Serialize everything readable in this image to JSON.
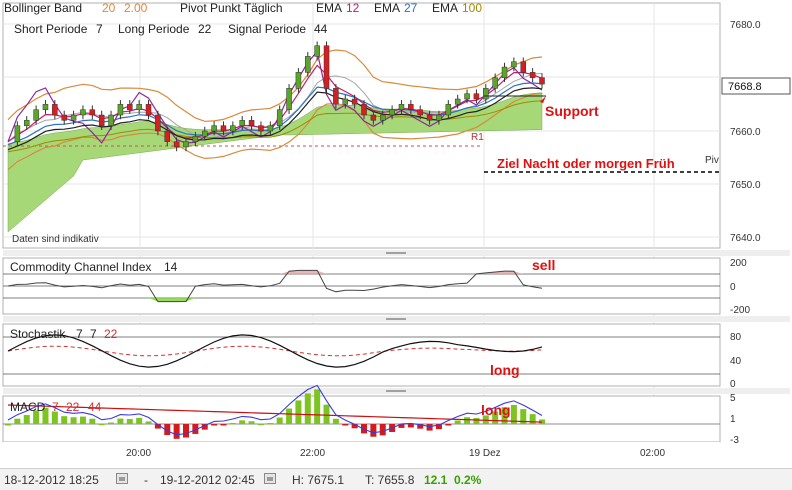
{
  "legend": {
    "bb_name": "Bollinger Band",
    "bb_p1": "20",
    "bb_p2": "2.00",
    "pivot": "Pivot Punkt  Täglich",
    "ema_label": "EMA",
    "ema1": "12",
    "ema2": "27",
    "ema3": "100",
    "short": "Short Periode",
    "short_v": "7",
    "long": "Long Periode",
    "long_v": "22",
    "signal": "Signal Periode",
    "signal_v": "44",
    "disclaimer": "Daten sind indikativ"
  },
  "annotations": {
    "support": "Support",
    "ziel": "Ziel Nacht oder morgen Früh",
    "piv": "Piv",
    "r1": "R1",
    "sell": "sell",
    "long1": "long",
    "long2": "long"
  },
  "indicators": {
    "cci": "Commodity Channel Index",
    "cci_v": "14",
    "stoch": "Stochastik",
    "stoch_v1": "7",
    "stoch_v2": "7",
    "stoch_v3": "22",
    "macd": "MACD",
    "macd_v1": "7",
    "macd_v2": "22",
    "macd_v3": "44"
  },
  "price_axis": [
    "7680.0",
    "7660.0",
    "7650.0",
    "7640.0"
  ],
  "price_marker": "7668.8",
  "cci_axis": [
    "200",
    "0",
    "-200"
  ],
  "stoch_axis": [
    "80",
    "40",
    "0"
  ],
  "macd_axis": [
    "5",
    "1",
    "-3"
  ],
  "time_axis": [
    "20:00",
    "22:00",
    "19 Dez",
    "02:00"
  ],
  "status": {
    "from": "18-12-2012 18:25",
    "sep": "-",
    "to": "19-12-2012 02:45",
    "high": "H: 7675.1",
    "low": "T: 7655.8",
    "change": "12.1",
    "change_pct": "0.2%"
  },
  "colors": {
    "ema12": "#c0206a",
    "ema27": "#2b73c6",
    "ema100": "#a08a00",
    "bollinger": "#d98a3a",
    "cloud": "#9ed46a",
    "up": "#5aa628",
    "down": "#d42020",
    "annotation": "#e01010",
    "change": "#3aa000"
  },
  "chart_data": {
    "type": "line",
    "x_ticks": [
      "20:00",
      "22:00",
      "19 Dez",
      "02:00"
    ],
    "ylim": [
      7637,
      7690
    ],
    "price_series": [
      7658,
      7661,
      7662,
      7664,
      7665,
      7663,
      7662,
      7663,
      7664,
      7663,
      7661,
      7663,
      7665,
      7664,
      7665,
      7663,
      7660,
      7658,
      7657,
      7658,
      7659,
      7660,
      7661,
      7660,
      7661,
      7662,
      7661,
      7660,
      7661,
      7664,
      7668,
      7671,
      7674,
      7676,
      7668,
      7665,
      7666,
      7665,
      7663,
      7662,
      7663,
      7664,
      7665,
      7664,
      7663,
      7662,
      7663,
      7665,
      7666,
      7667,
      7666,
      7668,
      7670,
      7672,
      7673,
      7671,
      7670,
      7668.8
    ],
    "markers": {
      "last": 7668.8
    }
  }
}
